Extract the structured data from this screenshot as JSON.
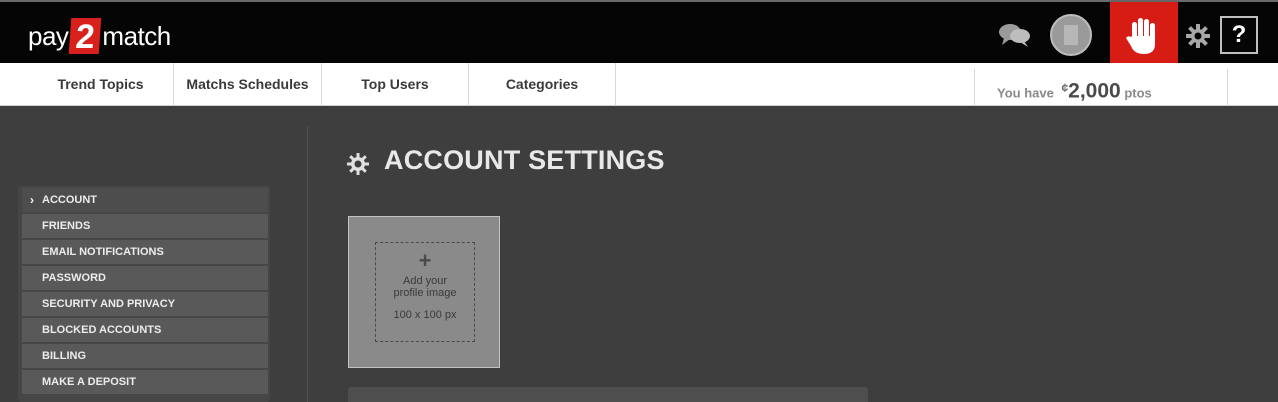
{
  "brand": {
    "pre": "pay",
    "num": "2",
    "post": "match"
  },
  "topbar": {
    "help_label": "?"
  },
  "nav": {
    "tabs": [
      {
        "label": "Trend Topics"
      },
      {
        "label": "Matchs Schedules"
      },
      {
        "label": "Top Users"
      },
      {
        "label": "Categories"
      }
    ],
    "points": {
      "prefix": "You have",
      "currency": "¢",
      "amount": "2,000",
      "unit": "ptos"
    }
  },
  "sidebar": {
    "items": [
      {
        "label": "ACCOUNT"
      },
      {
        "label": "FRIENDS"
      },
      {
        "label": "EMAIL NOTIFICATIONS"
      },
      {
        "label": "PASSWORD"
      },
      {
        "label": "SECURITY AND PRIVACY"
      },
      {
        "label": "BLOCKED ACCOUNTS"
      },
      {
        "label": "BILLING"
      },
      {
        "label": "MAKE A DEPOSIT"
      }
    ]
  },
  "main": {
    "title": "ACCOUNT SETTINGS",
    "upload": {
      "plus": "+",
      "line1": "Add your",
      "line2": "profile image",
      "size": "100 x 100 px"
    }
  },
  "colors": {
    "accent": "#d71c16",
    "topbar": "#050505",
    "content_bg": "#3e3e3e"
  }
}
